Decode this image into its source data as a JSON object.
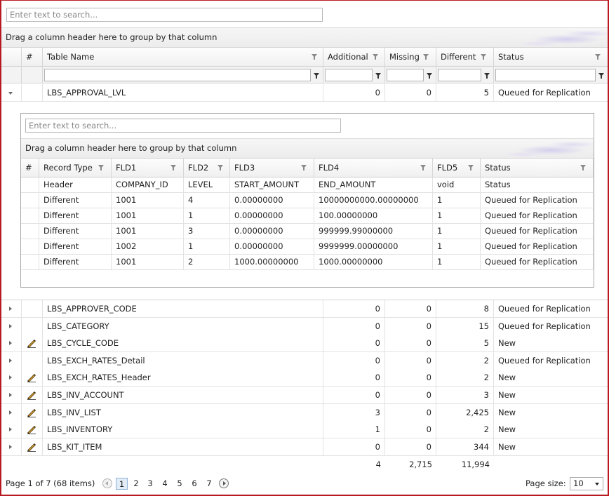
{
  "search": {
    "placeholder": "Enter text to search..."
  },
  "group_hint": "Drag a column header here to group by that column",
  "columns": [
    "#",
    "Table Name",
    "Additional",
    "Missing",
    "Different",
    "Status"
  ],
  "expanded_row": {
    "name": "LBS_APPROVAL_LVL",
    "additional": "0",
    "missing": "0",
    "different": "5",
    "status": "Queued for Replication"
  },
  "detail": {
    "search_placeholder": "Enter text to search...",
    "group_hint": "Drag a column header here to group by that column",
    "columns": [
      "#",
      "Record Type",
      "FLD1",
      "FLD2",
      "FLD3",
      "FLD4",
      "FLD5",
      "Status"
    ],
    "rows": [
      [
        "Header",
        "COMPANY_ID",
        "LEVEL",
        "START_AMOUNT",
        "END_AMOUNT",
        "void",
        "Status"
      ],
      [
        "Different",
        "1001",
        "4",
        "0.00000000",
        "10000000000.00000000",
        "1",
        "Queued for Replication"
      ],
      [
        "Different",
        "1001",
        "1",
        "0.00000000",
        "100.00000000",
        "1",
        "Queued for Replication"
      ],
      [
        "Different",
        "1001",
        "3",
        "0.00000000",
        "999999.99000000",
        "1",
        "Queued for Replication"
      ],
      [
        "Different",
        "1002",
        "1",
        "0.00000000",
        "9999999.00000000",
        "1",
        "Queued for Replication"
      ],
      [
        "Different",
        "1001",
        "2",
        "1000.00000000",
        "1000.00000000",
        "1",
        "Queued for Replication"
      ]
    ]
  },
  "rows": [
    {
      "name": "LBS_APPROVER_CODE",
      "additional": "0",
      "missing": "0",
      "different": "8",
      "status": "Queued for Replication",
      "edit_icon": false
    },
    {
      "name": "LBS_CATEGORY",
      "additional": "0",
      "missing": "0",
      "different": "15",
      "status": "Queued for Replication",
      "edit_icon": false
    },
    {
      "name": "LBS_CYCLE_CODE",
      "additional": "0",
      "missing": "0",
      "different": "5",
      "status": "New",
      "edit_icon": true
    },
    {
      "name": "LBS_EXCH_RATES_Detail",
      "additional": "0",
      "missing": "0",
      "different": "2",
      "status": "Queued for Replication",
      "edit_icon": false
    },
    {
      "name": "LBS_EXCH_RATES_Header",
      "additional": "0",
      "missing": "0",
      "different": "2",
      "status": "New",
      "edit_icon": true
    },
    {
      "name": "LBS_INV_ACCOUNT",
      "additional": "0",
      "missing": "0",
      "different": "3",
      "status": "New",
      "edit_icon": true
    },
    {
      "name": "LBS_INV_LIST",
      "additional": "3",
      "missing": "0",
      "different": "2,425",
      "status": "New",
      "edit_icon": true
    },
    {
      "name": "LBS_INVENTORY",
      "additional": "1",
      "missing": "0",
      "different": "2",
      "status": "New",
      "edit_icon": true
    },
    {
      "name": "LBS_KIT_ITEM",
      "additional": "0",
      "missing": "0",
      "different": "344",
      "status": "New",
      "edit_icon": true
    }
  ],
  "totals": {
    "additional": "4",
    "missing": "2,715",
    "different": "11,994"
  },
  "pager": {
    "info": "Page 1 of 7 (68 items)",
    "pages": [
      "1",
      "2",
      "3",
      "4",
      "5",
      "6",
      "7"
    ],
    "current": "1",
    "size_label": "Page size:",
    "size_value": "10"
  }
}
